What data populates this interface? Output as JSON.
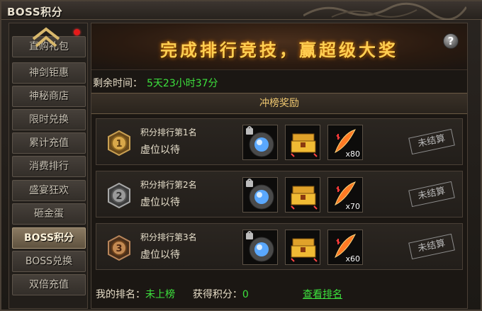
{
  "window": {
    "title": "BOSS积分"
  },
  "sidebar": {
    "items": [
      {
        "label": "直购礼包",
        "active": false
      },
      {
        "label": "神剑钜惠",
        "active": false
      },
      {
        "label": "神秘商店",
        "active": false
      },
      {
        "label": "限时兑换",
        "active": false
      },
      {
        "label": "累计充值",
        "active": false
      },
      {
        "label": "消费排行",
        "active": false
      },
      {
        "label": "盛宴狂欢",
        "active": false
      },
      {
        "label": "砸金蛋",
        "active": false
      },
      {
        "label": "BOSS积分",
        "active": true
      },
      {
        "label": "BOSS兑换",
        "active": false
      },
      {
        "label": "双倍充值",
        "active": false
      }
    ]
  },
  "banner": {
    "title": "完成排行竞技，赢超级大奖",
    "help_glyph": "?"
  },
  "time": {
    "label": "剩余时间：",
    "value": "5天23小时37分"
  },
  "reward_header": "冲榜奖励",
  "ranks": [
    {
      "medal": "1",
      "label": "积分排行第1名",
      "name": "虚位以待",
      "qty": "x80",
      "status": "未结算"
    },
    {
      "medal": "2",
      "label": "积分排行第2名",
      "name": "虚位以待",
      "qty": "x70",
      "status": "未结算"
    },
    {
      "medal": "3",
      "label": "积分排行第3名",
      "name": "虚位以待",
      "qty": "x60",
      "status": "未结算"
    }
  ],
  "footer": {
    "my_rank_label": "我的排名：",
    "my_rank_value": "未上榜",
    "points_label": "获得积分：",
    "points_value": "0",
    "view_rank": "查看排名"
  },
  "colors": {
    "accent_green": "#3de23d",
    "gold": "#ffcf52",
    "notify_red": "#e51a1a"
  }
}
